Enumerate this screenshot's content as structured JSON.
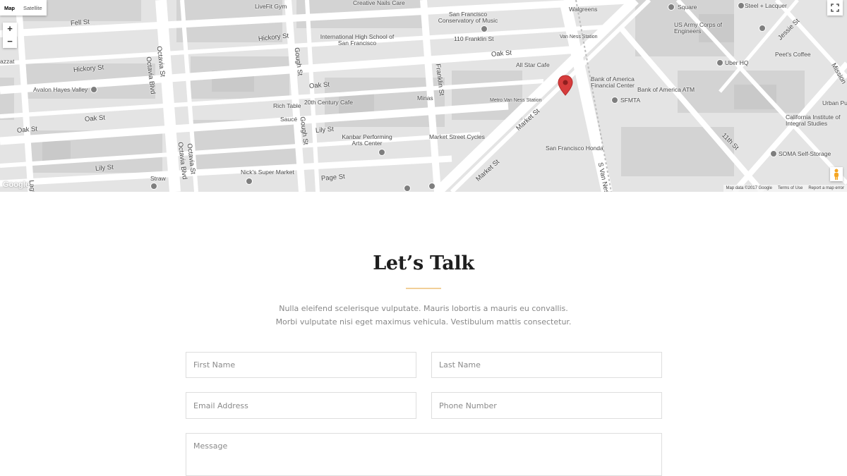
{
  "map": {
    "type_control": {
      "map_label": "Map",
      "satellite_label": "Satellite"
    },
    "zoom": {
      "in_label": "+",
      "out_label": "−"
    },
    "attribution": {
      "logo": "Google",
      "map_data": "Map data ©2017 Google",
      "terms": "Terms of Use",
      "report": "Report a map error"
    },
    "places": [
      "LiveFit Gym",
      "Creative Nails Care",
      "Walgreens",
      "Square",
      "Steel + Lacquer",
      "San Francisco Conservatory of Music",
      "US Army Corps of Engineers",
      "International High School of San Francisco",
      "110 Franklin St",
      "Van Ness Station",
      "Peet's Coffee",
      "Uber HQ",
      "All Star Cafe",
      "Bank of America Financial Center",
      "Bank of America ATM",
      "Avalon Hayes Valley",
      "Rich Table",
      "20th Century Cafe",
      "Minas",
      "Metro Van Ness Station",
      "SFMTA",
      "Urban Pu",
      "Saucé",
      "California Institute of Integral Studies",
      "Kanbar Performing Arts Center",
      "Market Street Cycles",
      "San Francisco Honda",
      "SOMA Self-Storage",
      "Nick's Super Market",
      "Straw",
      "azzat"
    ],
    "streets": [
      "Fell St",
      "Hickory St",
      "Hickory St",
      "Octavia Blvd",
      "Octavia St",
      "Gough St",
      "Oak St",
      "Oak St",
      "Oak St",
      "Oak St",
      "Franklin St",
      "Lily St",
      "Lily St",
      "Page St",
      "Market St",
      "Market St",
      "S Van Ness",
      "11th St",
      "Jessie St",
      "Gough St",
      "Octavia St",
      "Octavia Blvd",
      "Laguna",
      "Mission"
    ]
  },
  "contact": {
    "title": "Let’s Talk",
    "intro": "Nulla eleifend scelerisque vulputate. Mauris lobortis a mauris eu convallis. Morbi vulputate nisi eget maximus vehicula. Vestibulum mattis consectetur.",
    "fields": {
      "first_name": "First Name",
      "last_name": "Last Name",
      "email": "Email Address",
      "phone": "Phone Number",
      "message": "Message"
    }
  },
  "colors": {
    "accent_underline": "#f2cf98",
    "marker": "#d63c3c",
    "heading": "#1e1e1e"
  }
}
